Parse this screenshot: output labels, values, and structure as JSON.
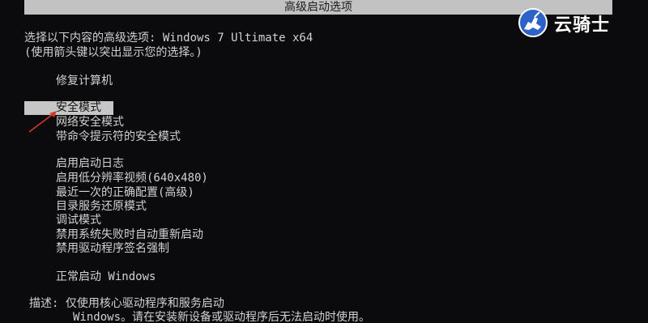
{
  "header": {
    "title": "高级启动选项"
  },
  "intro": {
    "line1": "选择以下内容的高级选项: Windows 7 Ultimate x64",
    "line2": "(使用箭头键以突出显示您的选择。)"
  },
  "options": {
    "repair": "修复计算机",
    "safe_mode": "安全模式",
    "safe_mode_network": "网络安全模式",
    "safe_mode_cmd": "带命令提示符的安全模式",
    "boot_logging": "启用启动日志",
    "low_res": "启用低分辨率视频(640x480)",
    "last_known_good": "最近一次的正确配置(高级)",
    "directory_restore": "目录服务还原模式",
    "debug": "调试模式",
    "disable_auto_restart": "禁用系统失败时自动重新启动",
    "disable_driver_sig": "禁用驱动程序签名强制",
    "start_normally": "正常启动 Windows"
  },
  "description": {
    "line1": "描述: 仅使用核心驱动程序和服务启动",
    "line2": "Windows。请在安装新设备或驱动程序后无法启动时使用。"
  },
  "watermark": {
    "text": "云骑士",
    "icon": "knight-horse-icon"
  },
  "colors": {
    "background": "#0b0b0d",
    "text": "#d2d2d2",
    "highlight": "#c6c6c6",
    "arrow": "#d23a2a"
  }
}
